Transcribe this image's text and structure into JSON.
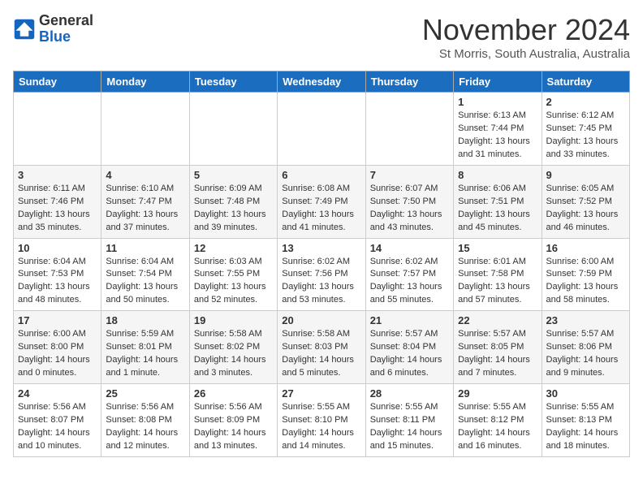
{
  "header": {
    "logo": {
      "general": "General",
      "blue": "Blue"
    },
    "title": "November 2024",
    "location": "St Morris, South Australia, Australia"
  },
  "calendar": {
    "headers": [
      "Sunday",
      "Monday",
      "Tuesday",
      "Wednesday",
      "Thursday",
      "Friday",
      "Saturday"
    ],
    "weeks": [
      [
        {
          "day": "",
          "info": ""
        },
        {
          "day": "",
          "info": ""
        },
        {
          "day": "",
          "info": ""
        },
        {
          "day": "",
          "info": ""
        },
        {
          "day": "",
          "info": ""
        },
        {
          "day": "1",
          "info": "Sunrise: 6:13 AM\nSunset: 7:44 PM\nDaylight: 13 hours\nand 31 minutes."
        },
        {
          "day": "2",
          "info": "Sunrise: 6:12 AM\nSunset: 7:45 PM\nDaylight: 13 hours\nand 33 minutes."
        }
      ],
      [
        {
          "day": "3",
          "info": "Sunrise: 6:11 AM\nSunset: 7:46 PM\nDaylight: 13 hours\nand 35 minutes."
        },
        {
          "day": "4",
          "info": "Sunrise: 6:10 AM\nSunset: 7:47 PM\nDaylight: 13 hours\nand 37 minutes."
        },
        {
          "day": "5",
          "info": "Sunrise: 6:09 AM\nSunset: 7:48 PM\nDaylight: 13 hours\nand 39 minutes."
        },
        {
          "day": "6",
          "info": "Sunrise: 6:08 AM\nSunset: 7:49 PM\nDaylight: 13 hours\nand 41 minutes."
        },
        {
          "day": "7",
          "info": "Sunrise: 6:07 AM\nSunset: 7:50 PM\nDaylight: 13 hours\nand 43 minutes."
        },
        {
          "day": "8",
          "info": "Sunrise: 6:06 AM\nSunset: 7:51 PM\nDaylight: 13 hours\nand 45 minutes."
        },
        {
          "day": "9",
          "info": "Sunrise: 6:05 AM\nSunset: 7:52 PM\nDaylight: 13 hours\nand 46 minutes."
        }
      ],
      [
        {
          "day": "10",
          "info": "Sunrise: 6:04 AM\nSunset: 7:53 PM\nDaylight: 13 hours\nand 48 minutes."
        },
        {
          "day": "11",
          "info": "Sunrise: 6:04 AM\nSunset: 7:54 PM\nDaylight: 13 hours\nand 50 minutes."
        },
        {
          "day": "12",
          "info": "Sunrise: 6:03 AM\nSunset: 7:55 PM\nDaylight: 13 hours\nand 52 minutes."
        },
        {
          "day": "13",
          "info": "Sunrise: 6:02 AM\nSunset: 7:56 PM\nDaylight: 13 hours\nand 53 minutes."
        },
        {
          "day": "14",
          "info": "Sunrise: 6:02 AM\nSunset: 7:57 PM\nDaylight: 13 hours\nand 55 minutes."
        },
        {
          "day": "15",
          "info": "Sunrise: 6:01 AM\nSunset: 7:58 PM\nDaylight: 13 hours\nand 57 minutes."
        },
        {
          "day": "16",
          "info": "Sunrise: 6:00 AM\nSunset: 7:59 PM\nDaylight: 13 hours\nand 58 minutes."
        }
      ],
      [
        {
          "day": "17",
          "info": "Sunrise: 6:00 AM\nSunset: 8:00 PM\nDaylight: 14 hours\nand 0 minutes."
        },
        {
          "day": "18",
          "info": "Sunrise: 5:59 AM\nSunset: 8:01 PM\nDaylight: 14 hours\nand 1 minute."
        },
        {
          "day": "19",
          "info": "Sunrise: 5:58 AM\nSunset: 8:02 PM\nDaylight: 14 hours\nand 3 minutes."
        },
        {
          "day": "20",
          "info": "Sunrise: 5:58 AM\nSunset: 8:03 PM\nDaylight: 14 hours\nand 5 minutes."
        },
        {
          "day": "21",
          "info": "Sunrise: 5:57 AM\nSunset: 8:04 PM\nDaylight: 14 hours\nand 6 minutes."
        },
        {
          "day": "22",
          "info": "Sunrise: 5:57 AM\nSunset: 8:05 PM\nDaylight: 14 hours\nand 7 minutes."
        },
        {
          "day": "23",
          "info": "Sunrise: 5:57 AM\nSunset: 8:06 PM\nDaylight: 14 hours\nand 9 minutes."
        }
      ],
      [
        {
          "day": "24",
          "info": "Sunrise: 5:56 AM\nSunset: 8:07 PM\nDaylight: 14 hours\nand 10 minutes."
        },
        {
          "day": "25",
          "info": "Sunrise: 5:56 AM\nSunset: 8:08 PM\nDaylight: 14 hours\nand 12 minutes."
        },
        {
          "day": "26",
          "info": "Sunrise: 5:56 AM\nSunset: 8:09 PM\nDaylight: 14 hours\nand 13 minutes."
        },
        {
          "day": "27",
          "info": "Sunrise: 5:55 AM\nSunset: 8:10 PM\nDaylight: 14 hours\nand 14 minutes."
        },
        {
          "day": "28",
          "info": "Sunrise: 5:55 AM\nSunset: 8:11 PM\nDaylight: 14 hours\nand 15 minutes."
        },
        {
          "day": "29",
          "info": "Sunrise: 5:55 AM\nSunset: 8:12 PM\nDaylight: 14 hours\nand 16 minutes."
        },
        {
          "day": "30",
          "info": "Sunrise: 5:55 AM\nSunset: 8:13 PM\nDaylight: 14 hours\nand 18 minutes."
        }
      ]
    ]
  }
}
